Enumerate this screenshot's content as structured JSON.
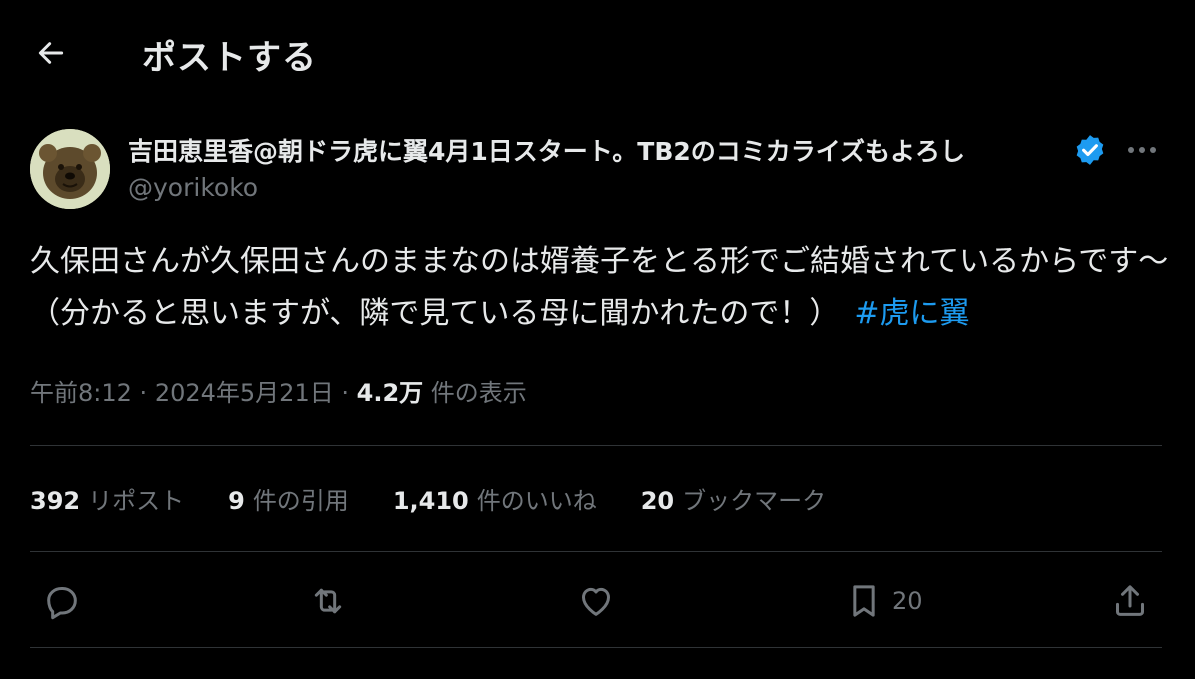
{
  "header": {
    "title": "ポストする"
  },
  "author": {
    "display_name": "吉田恵里香@朝ドラ虎に翼4月1日スタート。TB2のコミカライズもよろし",
    "handle": "@yorikoko"
  },
  "tweet": {
    "text": "久保田さんが久保田さんのままなのは婿養子をとる形でご結婚されているからです〜（分かると思いますが、隣で見ている母に聞かれたので！）",
    "hashtag": "#虎に翼"
  },
  "meta": {
    "time": "午前8:12",
    "sep1": "·",
    "date": "2024年5月21日",
    "sep2": "·",
    "views_count": "4.2万",
    "views_label": "件の表示"
  },
  "stats": [
    {
      "count": "392",
      "label": "リポスト"
    },
    {
      "count": "9",
      "label": "件の引用"
    },
    {
      "count": "1,410",
      "label": "件のいいね"
    },
    {
      "count": "20",
      "label": "ブックマーク"
    }
  ],
  "actions": {
    "bookmark_count": "20"
  },
  "colors": {
    "accent": "#1d9bf0",
    "muted": "#71767b",
    "text": "#e7e9ea",
    "divider": "#2f3336"
  },
  "icons": [
    "back-arrow-icon",
    "verified-badge-icon",
    "more-icon",
    "reply-icon",
    "repost-icon",
    "like-icon",
    "bookmark-icon",
    "share-icon"
  ]
}
